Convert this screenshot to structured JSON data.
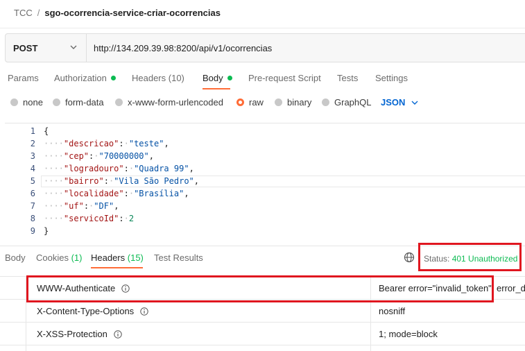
{
  "breadcrumb": {
    "workspace": "TCC",
    "separator": "/",
    "request": "sgo-ocorrencia-service-criar-ocorrencias"
  },
  "request": {
    "method": "POST",
    "url": "http://134.209.39.98:8200/api/v1/ocorrencias"
  },
  "tabs": [
    {
      "label": "Params"
    },
    {
      "label": "Authorization"
    },
    {
      "label": "Headers",
      "count": "(10)"
    },
    {
      "label": "Body"
    },
    {
      "label": "Pre-request Script"
    },
    {
      "label": "Tests"
    },
    {
      "label": "Settings"
    }
  ],
  "body_modes": [
    "none",
    "form-data",
    "x-www-form-urlencoded",
    "raw",
    "binary",
    "GraphQL"
  ],
  "body_mode_selected": "raw",
  "language": "JSON",
  "code": {
    "line_numbers": [
      "1",
      "2",
      "3",
      "4",
      "5",
      "6",
      "7",
      "8",
      "9"
    ],
    "open": "{",
    "close": "}",
    "fields": [
      {
        "key": "\"descricao\"",
        "value": "\"teste\"",
        "comma": ","
      },
      {
        "key": "\"cep\"",
        "value": "\"70000000\"",
        "comma": ","
      },
      {
        "key": "\"logradouro\"",
        "value": "\"Quadra 99\"",
        "comma": ","
      },
      {
        "key": "\"bairro\"",
        "value": "\"Vila São Pedro\"",
        "comma": ","
      },
      {
        "key": "\"localidade\"",
        "value": "\"Brasília\"",
        "comma": ","
      },
      {
        "key": "\"uf\"",
        "value": "\"DF\"",
        "comma": ","
      },
      {
        "key": "\"servicoId\"",
        "value": "2",
        "comma": ""
      }
    ]
  },
  "response_tabs": [
    {
      "label": "Body"
    },
    {
      "label": "Cookies",
      "count": "(1)"
    },
    {
      "label": "Headers",
      "count": "(15)"
    },
    {
      "label": "Test Results"
    }
  ],
  "status": {
    "label": "Status:",
    "code": "401 Unauthorized"
  },
  "response_headers": [
    {
      "key": "WWW-Authenticate",
      "value": "Bearer error=\"invalid_token\", error_de"
    },
    {
      "key": "X-Content-Type-Options",
      "value": "nosniff"
    },
    {
      "key": "X-XSS-Protection",
      "value": "1; mode=block"
    }
  ],
  "colors": {
    "accent": "#ff6c37",
    "success": "#0cbb52",
    "link": "#0265d2",
    "highlight": "#e0161f"
  }
}
